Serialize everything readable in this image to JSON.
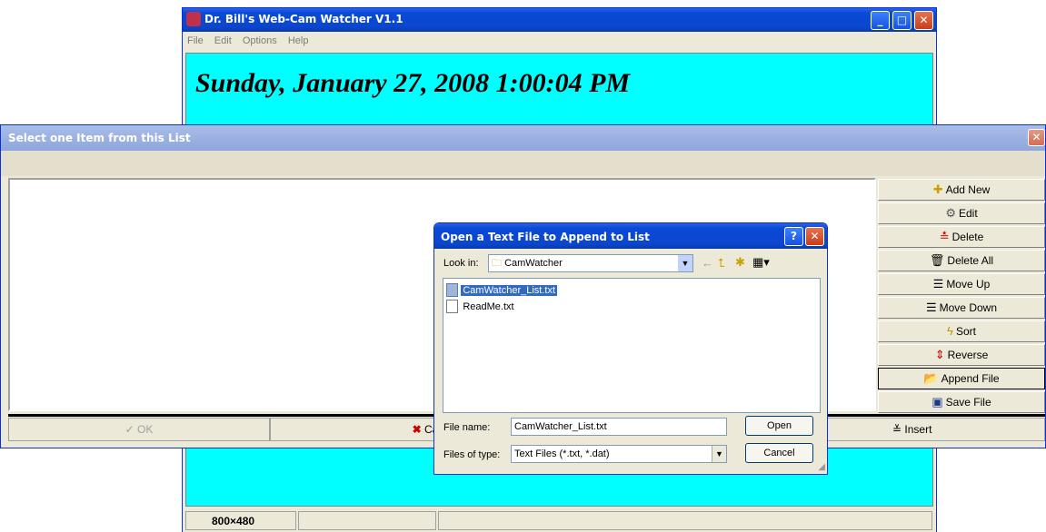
{
  "main_window": {
    "title": "Dr. Bill's Web-Cam Watcher V1.1",
    "menu": [
      "File",
      "Edit",
      "Options",
      "Help"
    ],
    "datetime": "Sunday, January 27, 2008 1:00:04 PM",
    "status_resolution": "800×480",
    "colors": {
      "display_bg": "#00ffff"
    }
  },
  "list_dialog": {
    "title": "Select one Item from this List",
    "side_buttons": [
      {
        "label": "Add New",
        "icon": "plus-icon"
      },
      {
        "label": "Edit",
        "icon": "edit-icon"
      },
      {
        "label": "Delete",
        "icon": "delete-icon"
      },
      {
        "label": "Delete All",
        "icon": "trash-icon"
      },
      {
        "label": "Move Up",
        "icon": "move-up-icon"
      },
      {
        "label": "Move Down",
        "icon": "move-down-icon"
      },
      {
        "label": "Sort",
        "icon": "sort-icon"
      },
      {
        "label": "Reverse",
        "icon": "reverse-icon"
      },
      {
        "label": "Append File",
        "icon": "folder-open-icon"
      },
      {
        "label": "Save File",
        "icon": "save-icon"
      }
    ],
    "bottom_buttons": {
      "ok": "OK",
      "cancel": "Cancel",
      "insert": "Insert"
    }
  },
  "open_dialog": {
    "title": "Open a Text File to Append to List",
    "look_in_label": "Look in:",
    "look_in_value": "CamWatcher",
    "files": [
      {
        "name": "CamWatcher_List.txt",
        "selected": true
      },
      {
        "name": "ReadMe.txt",
        "selected": false
      }
    ],
    "file_name_label": "File name:",
    "file_name_value": "CamWatcher_List.txt",
    "files_of_type_label": "Files of type:",
    "files_of_type_value": "Text Files (*.txt, *.dat)",
    "open_button": "Open",
    "cancel_button": "Cancel"
  }
}
